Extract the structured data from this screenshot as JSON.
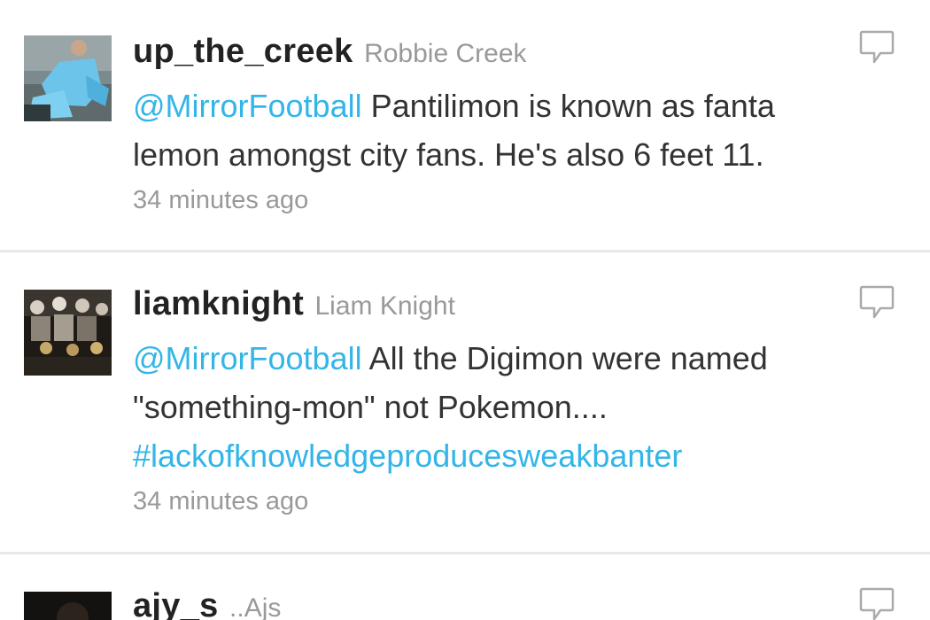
{
  "tweets": [
    {
      "screen_name": "up_the_creek",
      "full_name": "Robbie Creek",
      "mention": "@MirrorFootball",
      "text": "Pantilimon is known as fanta lemon amongst city fans. He's also 6 feet 11.",
      "hashtag": "",
      "time": "34 minutes ago",
      "avatar_icon": "football-player-avatar"
    },
    {
      "screen_name": "liamknight",
      "full_name": "Liam Knight",
      "mention": "@MirrorFootball",
      "text": "All the Digimon were named \"something-mon\" not Pokemon....",
      "hashtag": "#lackofknowledgeproducesweakbanter",
      "time": "34 minutes ago",
      "avatar_icon": "crowd-avatar"
    },
    {
      "screen_name": "ajy_s",
      "full_name": "..Ajs",
      "avatar_icon": "dark-avatar"
    }
  ],
  "colors": {
    "link": "#33b5e8",
    "muted": "#999999",
    "divider": "#e8e8e8"
  },
  "icons": {
    "reply": "speech-bubble-icon"
  }
}
